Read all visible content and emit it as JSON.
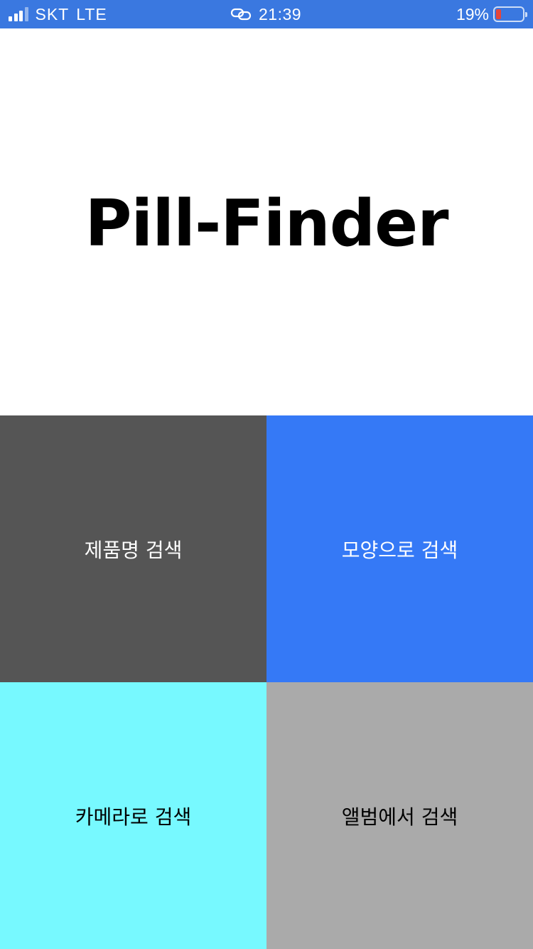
{
  "status_bar": {
    "carrier": "SKT",
    "network": "LTE",
    "time": "21:39",
    "battery_percent": "19%",
    "battery_level": 0.19,
    "signal_bars_filled": 3,
    "signal_bars_total": 4,
    "background_color": "#3a78e0",
    "link_icon": "link-icon"
  },
  "app": {
    "title": "Pill-Finder"
  },
  "menu": [
    {
      "label": "제품명 검색",
      "bg_color": "#555555",
      "text_color": "#ffffff"
    },
    {
      "label": "모양으로 검색",
      "bg_color": "#3579f6",
      "text_color": "#ffffff"
    },
    {
      "label": "카메라로 검색",
      "bg_color": "#77f9ff",
      "text_color": "#000000"
    },
    {
      "label": "앨범에서 검색",
      "bg_color": "#aaaaaa",
      "text_color": "#000000"
    }
  ]
}
